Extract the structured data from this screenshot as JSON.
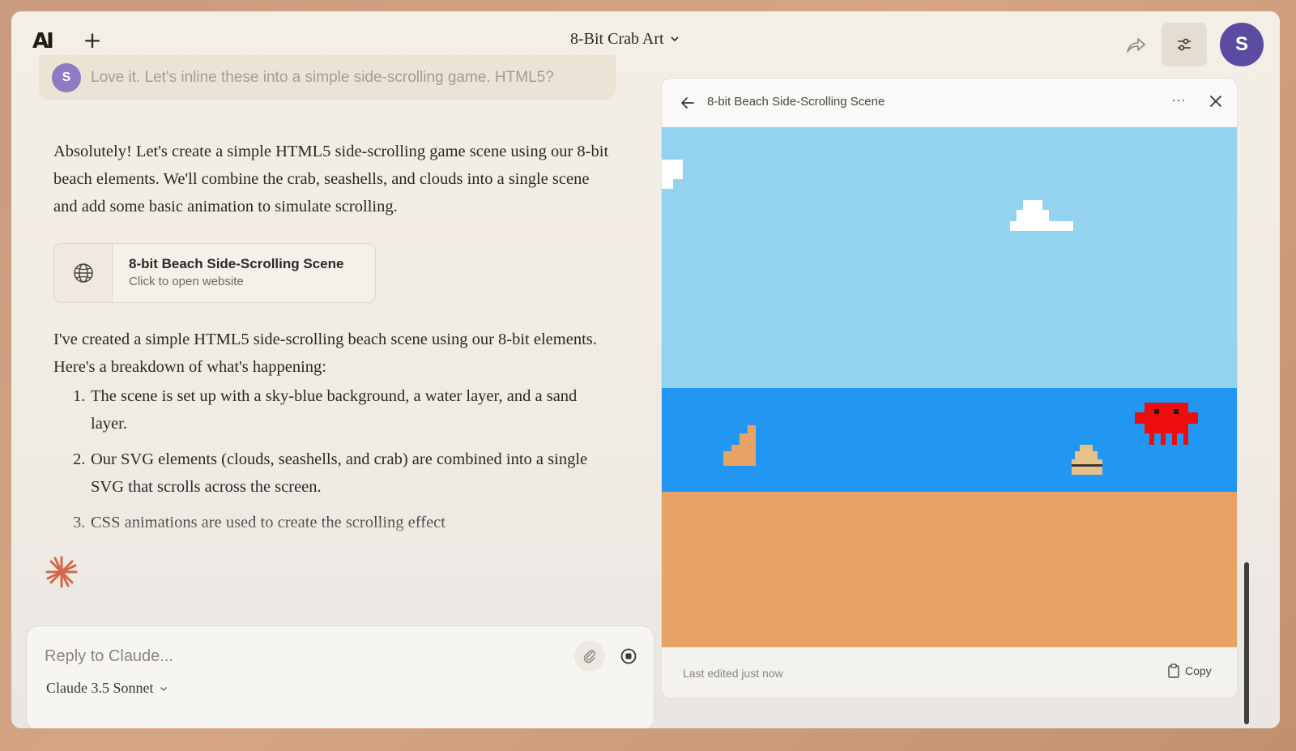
{
  "header": {
    "logo_text": "AI",
    "new_chat_label": "+",
    "chat_title": "8-Bit Crab Art",
    "user_initial": "S"
  },
  "user_message": {
    "initial": "S",
    "text": "Love it. Let's inline these into a simple side-scrolling game. HTML5?"
  },
  "assistant": {
    "intro": "Absolutely! Let's create a simple HTML5 side-scrolling game scene using our 8-bit beach elements. We'll combine the crab, seashells, and clouds into a single scene and add some basic animation to simulate scrolling.",
    "artifact": {
      "name": "8-bit Beach Side-Scrolling Scene",
      "subtitle": "Click to open website",
      "icon": "globe-icon"
    },
    "body": "I've created a simple HTML5 side-scrolling beach scene using our 8-bit elements. Here's a breakdown of what's happening:",
    "steps": [
      {
        "num": "1.",
        "text": "The scene is set up with a sky-blue background, a water layer, and a sand layer."
      },
      {
        "num": "2.",
        "text": "Our SVG elements (clouds, seashells, and crab) are combined into a single SVG that scrolls across the screen."
      },
      {
        "num": "3.",
        "text": "CSS animations are used to create the scrolling effect"
      }
    ]
  },
  "composer": {
    "placeholder": "Reply to Claude...",
    "model": "Claude 3.5 Sonnet"
  },
  "panel": {
    "title": "8-bit Beach Side-Scrolling Scene",
    "more_label": "···",
    "last_edited": "Last edited just now",
    "copy_label": "Copy"
  },
  "colors": {
    "sky": "#93d3f0",
    "water": "#2196f3",
    "sand": "#e8a263",
    "crab": "#ee0d0d",
    "accent_avatar": "#5c4ba3",
    "spark": "#d4694a"
  }
}
